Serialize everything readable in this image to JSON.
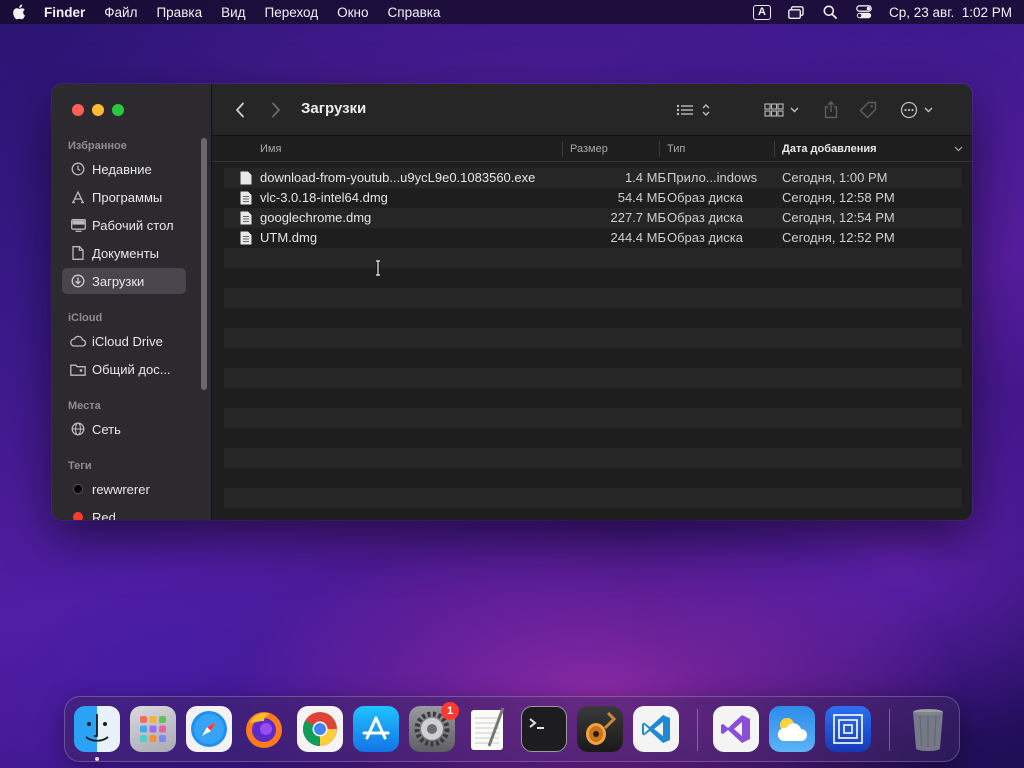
{
  "menubar": {
    "app_name": "Finder",
    "items": [
      "Файл",
      "Правка",
      "Вид",
      "Переход",
      "Окно",
      "Справка"
    ],
    "input_source": "A",
    "clock": "Ср, 23 авг.  1:02 PM"
  },
  "window": {
    "title": "Загрузки",
    "sidebar": {
      "favorites_label": "Избранное",
      "favorites": [
        {
          "label": "Недавние",
          "icon": "clock-icon"
        },
        {
          "label": "Программы",
          "icon": "apps-icon"
        },
        {
          "label": "Рабочий стол",
          "icon": "desktop-icon"
        },
        {
          "label": "Документы",
          "icon": "document-icon"
        },
        {
          "label": "Загрузки",
          "icon": "download-icon",
          "active": true
        }
      ],
      "icloud_label": "iCloud",
      "icloud": [
        {
          "label": "iCloud Drive",
          "icon": "cloud-icon"
        },
        {
          "label": "Общий дос...",
          "icon": "shared-folder-icon"
        }
      ],
      "places_label": "Места",
      "places": [
        {
          "label": "Сеть",
          "icon": "globe-icon"
        }
      ],
      "tags_label": "Теги",
      "tags": [
        {
          "label": "rewwrerer",
          "color": "#000000"
        },
        {
          "label": "Red",
          "color": "#ff3b30"
        }
      ]
    },
    "columns": {
      "name": "Имя",
      "size": "Размер",
      "kind": "Тип",
      "date_added": "Дата добавления"
    },
    "files": [
      {
        "name": "download-from-youtub...u9ycL9e0.1083560.exe",
        "size": "1.4 МБ",
        "kind": "Прило...indows",
        "date": "Сегодня, 1:00 PM"
      },
      {
        "name": "vlc-3.0.18-intel64.dmg",
        "size": "54.4 МБ",
        "kind": "Образ диска",
        "date": "Сегодня, 12:58 PM"
      },
      {
        "name": "googlechrome.dmg",
        "size": "227.7 МБ",
        "kind": "Образ диска",
        "date": "Сегодня, 12:54 PM"
      },
      {
        "name": "UTM.dmg",
        "size": "244.4 МБ",
        "kind": "Образ диска",
        "date": "Сегодня, 12:52 PM"
      }
    ]
  },
  "dock": {
    "apps": [
      {
        "name": "finder-icon",
        "running": true
      },
      {
        "name": "launchpad-icon"
      },
      {
        "name": "safari-icon"
      },
      {
        "name": "firefox-icon"
      },
      {
        "name": "chrome-icon"
      },
      {
        "name": "app-store-icon"
      },
      {
        "name": "system-settings-icon",
        "badge": "1"
      },
      {
        "name": "textedit-icon"
      },
      {
        "name": "terminal-icon"
      },
      {
        "name": "garageband-icon"
      },
      {
        "name": "vscode-icon"
      },
      {
        "name": "visual-studio-icon"
      },
      {
        "name": "weather-icon"
      },
      {
        "name": "screen-sharing-icon"
      },
      {
        "name": "trash-icon"
      }
    ]
  }
}
